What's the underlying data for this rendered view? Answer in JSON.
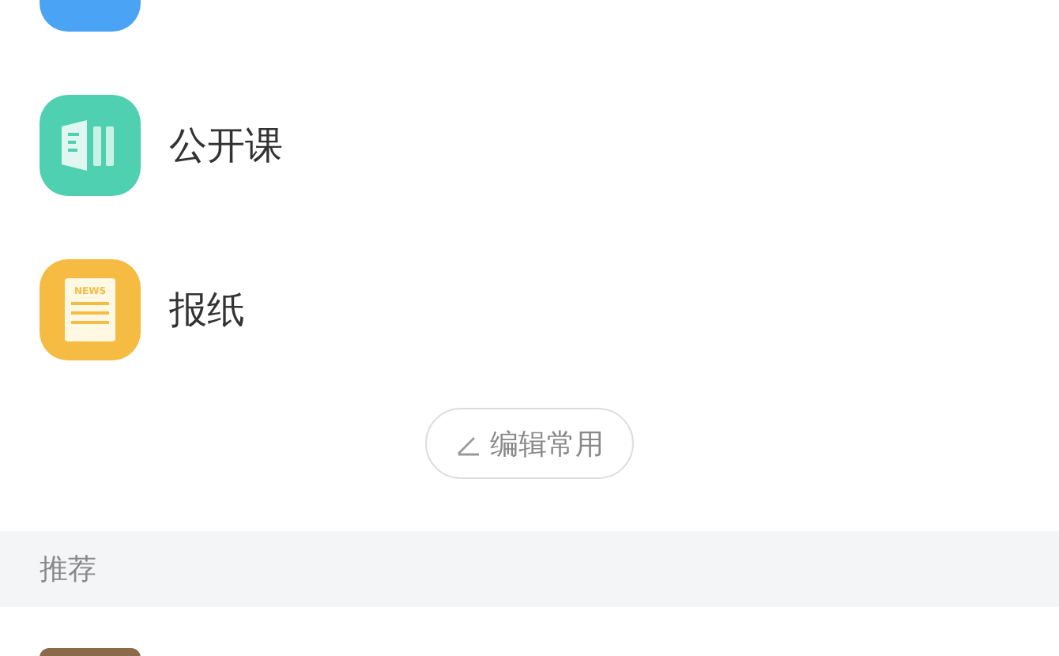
{
  "items": [
    {
      "kind": "blue-card"
    },
    {
      "kind": "course",
      "label": "公开课"
    },
    {
      "kind": "news",
      "label": "报纸",
      "icon_text": "NEWS"
    }
  ],
  "edit_button": {
    "label": "编辑常用"
  },
  "section": {
    "title": "推荐"
  },
  "recommendations": [
    {
      "kind": "thumbnail"
    }
  ]
}
